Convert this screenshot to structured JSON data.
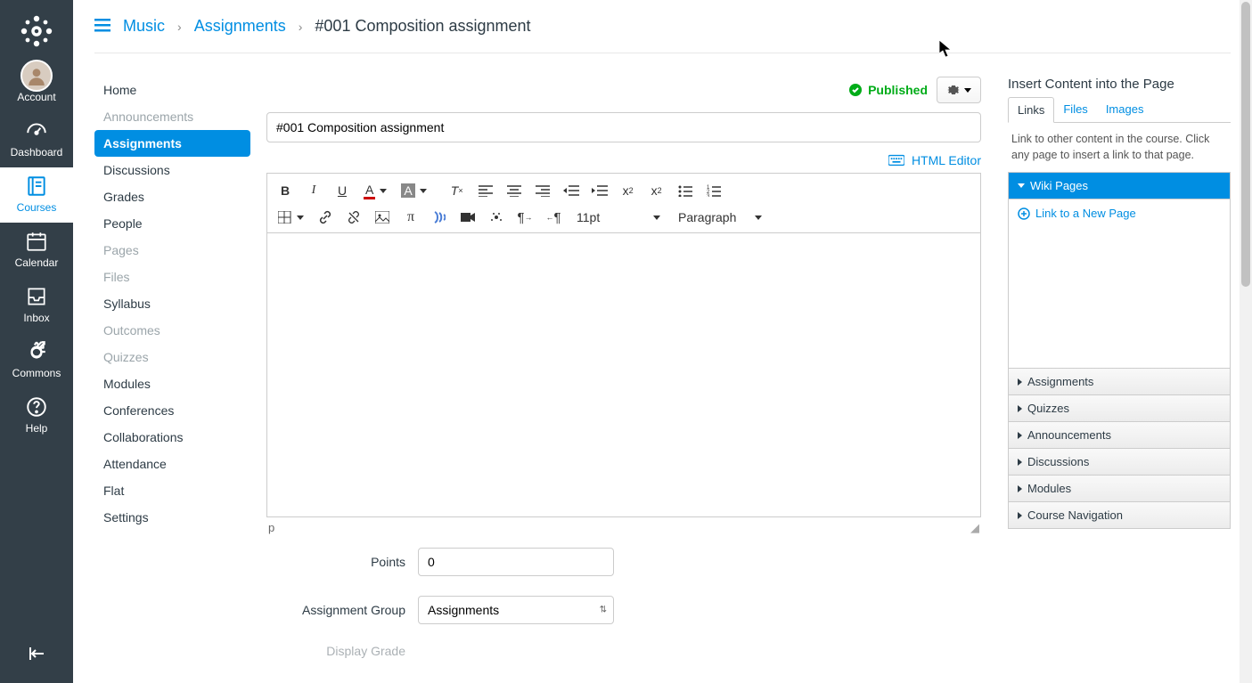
{
  "global_nav": {
    "items": [
      {
        "id": "account",
        "label": "Account"
      },
      {
        "id": "dashboard",
        "label": "Dashboard"
      },
      {
        "id": "courses",
        "label": "Courses"
      },
      {
        "id": "calendar",
        "label": "Calendar"
      },
      {
        "id": "inbox",
        "label": "Inbox"
      },
      {
        "id": "commons",
        "label": "Commons"
      },
      {
        "id": "help",
        "label": "Help"
      }
    ],
    "active": "courses"
  },
  "breadcrumb": {
    "course": "Music",
    "section": "Assignments",
    "current": "#001 Composition assignment"
  },
  "course_nav": {
    "items": [
      {
        "label": "Home"
      },
      {
        "label": "Announcements",
        "muted": true
      },
      {
        "label": "Assignments",
        "active": true
      },
      {
        "label": "Discussions"
      },
      {
        "label": "Grades"
      },
      {
        "label": "People"
      },
      {
        "label": "Pages",
        "muted": true
      },
      {
        "label": "Files",
        "muted": true
      },
      {
        "label": "Syllabus"
      },
      {
        "label": "Outcomes",
        "muted": true
      },
      {
        "label": "Quizzes",
        "muted": true
      },
      {
        "label": "Modules"
      },
      {
        "label": "Conferences"
      },
      {
        "label": "Collaborations"
      },
      {
        "label": "Attendance"
      },
      {
        "label": "Flat"
      },
      {
        "label": "Settings"
      }
    ]
  },
  "editor": {
    "published_label": "Published",
    "title_value": "#001 Composition assignment",
    "html_editor_label": "HTML Editor",
    "font_size": "11pt",
    "block_format": "Paragraph",
    "path": "p"
  },
  "form": {
    "points_label": "Points",
    "points_value": "0",
    "group_label": "Assignment Group",
    "group_value": "Assignments",
    "display_grade_label": "Display Grade"
  },
  "sidebar": {
    "title": "Insert Content into the Page",
    "tabs": [
      "Links",
      "Files",
      "Images"
    ],
    "active_tab": "Links",
    "help_text": "Link to other content in the course. Click any page to insert a link to that page.",
    "wiki_pages_label": "Wiki Pages",
    "link_new_page": "Link to a New Page",
    "accordions": [
      "Assignments",
      "Quizzes",
      "Announcements",
      "Discussions",
      "Modules",
      "Course Navigation"
    ]
  },
  "colors": {
    "link": "#008ee2",
    "success": "#00ac18",
    "navbg": "#333f48"
  }
}
